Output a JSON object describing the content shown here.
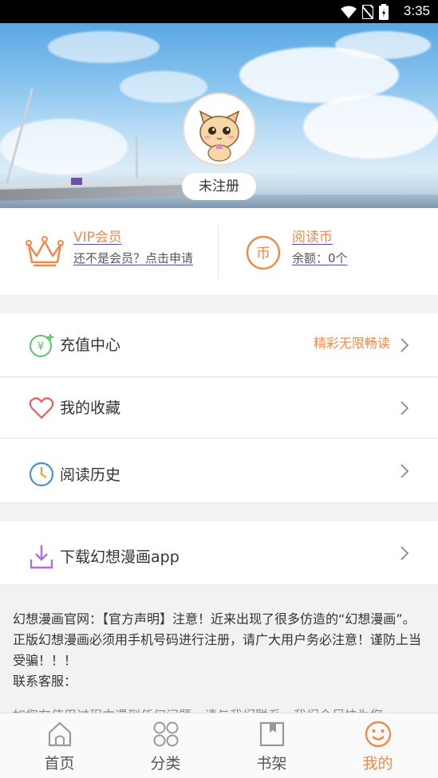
{
  "status_bar": {
    "time": "3:35"
  },
  "profile": {
    "register_label": "未注册"
  },
  "vip": {
    "title": "VIP会员",
    "subtitle": "还不是会员？点击申请"
  },
  "coins": {
    "title": "阅读币",
    "balance": "余额：0个"
  },
  "menu": {
    "recharge": {
      "label": "充值中心",
      "promo": "精彩无限畅读"
    },
    "favorites": {
      "label": "我的收藏"
    },
    "history": {
      "label": "阅读历史"
    },
    "download": {
      "label": "下载幻想漫画app"
    }
  },
  "notice": {
    "text": "幻想漫画官网：【官方声明】注意！近来出现了很多仿造的“幻想漫画”。正版幻想漫画必须用手机号码进行注册，请广大用户务必注意！谨防上当受骗！！！",
    "contact": "联系客服：",
    "help": "如您在使用过程中遇到任何问题，请与我们联系，我们会尽快为您"
  },
  "tabs": [
    {
      "label": "首页",
      "icon": "home-icon",
      "active": false
    },
    {
      "label": "分类",
      "icon": "grid-icon",
      "active": false
    },
    {
      "label": "书架",
      "icon": "bookshelf-icon",
      "active": false
    },
    {
      "label": "我的",
      "icon": "smiley-icon",
      "active": true
    }
  ],
  "colors": {
    "accent": "#f08a4b",
    "link_underline": "#4b4bd0"
  }
}
